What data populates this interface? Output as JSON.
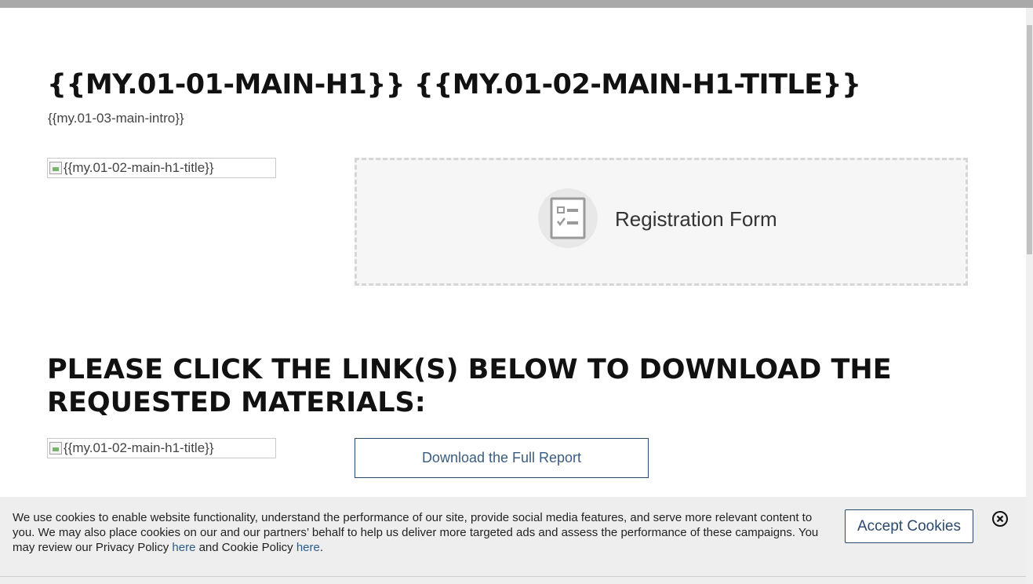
{
  "page": {
    "title_part1": "{{MY.01-01-MAIN-H1}}",
    "title_part2": "{{MY.01-02-MAIN-H1-TITLE}}",
    "intro": "{{my.01-03-main-intro}}",
    "image_alt": "{{my.01-02-main-h1-title}}"
  },
  "form": {
    "label": "Registration Form",
    "icon": "form-checklist-icon"
  },
  "downloads": {
    "heading": "PLEASE CLICK THE LINK(S) BELOW TO DOWNLOAD THE REQUESTED MATERIALS:",
    "image_alt": "{{my.01-02-main-h1-title}}",
    "button_label": "Download the Full Report"
  },
  "cookie_banner": {
    "text_start": "We use cookies to enable website functionality, understand the performance of our site, provide social media features, and serve more relevant content to you. We may also place cookies on our and our partners’ behalf to help us deliver more targeted ads and assess the performance of these campaigns. You may review our Privacy Policy ",
    "privacy_link": "here",
    "text_middle": " and Cookie Policy ",
    "cookie_link": "here",
    "text_end": ".",
    "accept_label": "Accept Cookies",
    "close_icon": "close-circle-icon"
  },
  "colors": {
    "accent": "#2b4a6b",
    "link": "#2b5b8a",
    "banner_bg": "#eeeeef"
  }
}
